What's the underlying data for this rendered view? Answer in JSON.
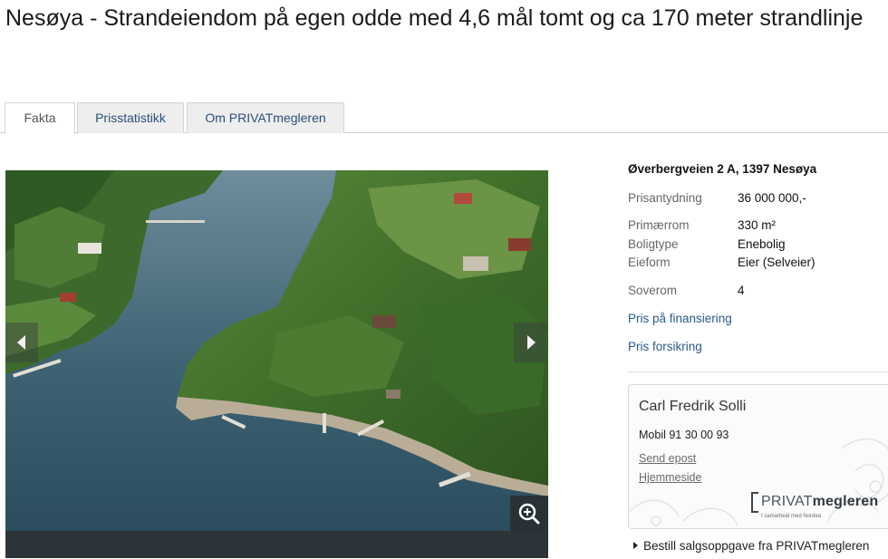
{
  "listing": {
    "title": "Nesøya - Strandeiendom på egen odde med 4,6 mål tomt og ca 170 meter strandlinje"
  },
  "tabs": [
    {
      "label": "Fakta",
      "active": true
    },
    {
      "label": "Prisstatistikk",
      "active": false
    },
    {
      "label": "Om PRIVATmegleren",
      "active": false
    }
  ],
  "gallery": {
    "prev_icon": "chevron-left-icon",
    "next_icon": "chevron-right-icon",
    "zoom_icon": "zoom-in-icon"
  },
  "facts": {
    "address": "Øverbergveien 2 A, 1397 Nesøya",
    "rows": [
      {
        "label": "Prisantydning",
        "value": "36 000 000,-"
      },
      {
        "label": "Primærrom",
        "value": "330 m²"
      },
      {
        "label": "Boligtype",
        "value": "Enebolig"
      },
      {
        "label": "Eieform",
        "value": "Eier (Selveier)"
      },
      {
        "label": "Soverom",
        "value": "4"
      }
    ],
    "links": [
      "Pris på finansiering",
      "Pris forsikring"
    ]
  },
  "agent": {
    "name": "Carl Fredrik Solli",
    "mobile": "Mobil  91 30 00 93",
    "email_link": "Send epost",
    "homepage_link": "Hjemmeside"
  },
  "logo": {
    "brand_light": "PRIVAT",
    "brand_bold": "megleren",
    "tagline": "I samarbeid med Nordea"
  },
  "order_link": "Bestill salgsoppgave fra PRIVATmegleren",
  "colors": {
    "link": "#2a5a8c",
    "tab_background": "#eeeeee",
    "photo_bar": "#2c3439"
  }
}
